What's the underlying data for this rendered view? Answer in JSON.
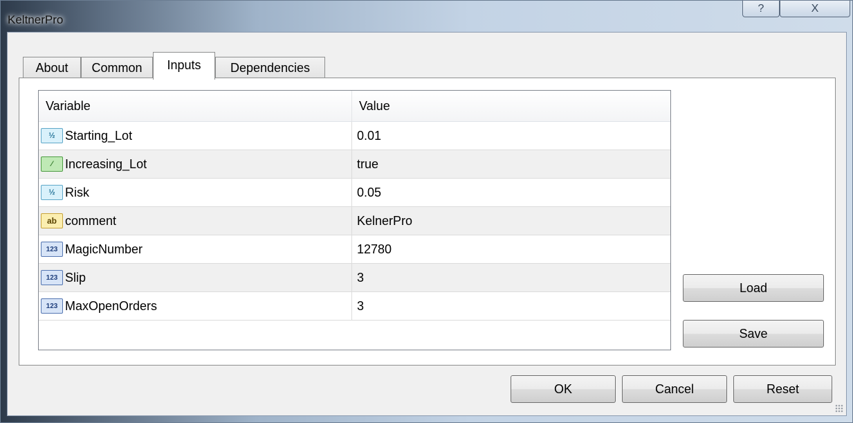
{
  "window": {
    "title": "KeltnerPro",
    "help_glyph": "?",
    "close_glyph": "X"
  },
  "tabs": [
    {
      "label": "About"
    },
    {
      "label": "Common"
    },
    {
      "label": "Inputs",
      "active": true
    },
    {
      "label": "Dependencies"
    }
  ],
  "grid": {
    "columns": [
      "Variable",
      "Value"
    ],
    "rows": [
      {
        "icon": "double-icon",
        "icon_text": "½",
        "variable": "Starting_Lot",
        "value": "0.01"
      },
      {
        "icon": "bool-icon",
        "icon_text": "⁄",
        "variable": "Increasing_Lot",
        "value": "true"
      },
      {
        "icon": "double-icon",
        "icon_text": "½",
        "variable": "Risk",
        "value": "0.05"
      },
      {
        "icon": "string-icon",
        "icon_text": "ab",
        "variable": "comment",
        "value": "KelnerPro"
      },
      {
        "icon": "int-icon",
        "icon_text": "123",
        "variable": "MagicNumber",
        "value": "12780"
      },
      {
        "icon": "int-icon",
        "icon_text": "123",
        "variable": "Slip",
        "value": "3"
      },
      {
        "icon": "int-icon",
        "icon_text": "123",
        "variable": "MaxOpenOrders",
        "value": "3"
      }
    ]
  },
  "side_buttons": {
    "load": "Load",
    "save": "Save"
  },
  "footer_buttons": {
    "ok": "OK",
    "cancel": "Cancel",
    "reset": "Reset"
  }
}
